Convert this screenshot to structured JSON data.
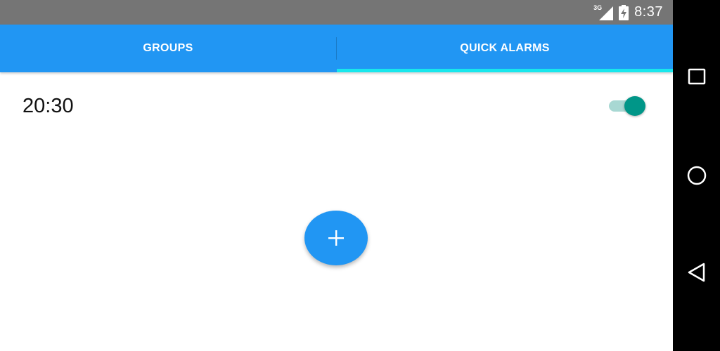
{
  "status_bar": {
    "network_label": "3G",
    "time": "8:37",
    "icons": [
      "signal-icon",
      "battery-charging-icon"
    ]
  },
  "tabs": [
    {
      "label": "GROUPS",
      "selected": false
    },
    {
      "label": "QUICK ALARMS",
      "selected": true
    }
  ],
  "alarms": [
    {
      "time": "20:30",
      "enabled": true
    }
  ],
  "fab": {
    "icon": "plus-icon"
  },
  "nav_bar": {
    "icons": [
      "recents-icon",
      "home-icon",
      "back-icon"
    ]
  },
  "colors": {
    "primary": "#2196f3",
    "tab_indicator": "#18e7ec",
    "toggle_on": "#009688",
    "status_bar": "#757575",
    "nav_bar": "#000000"
  }
}
